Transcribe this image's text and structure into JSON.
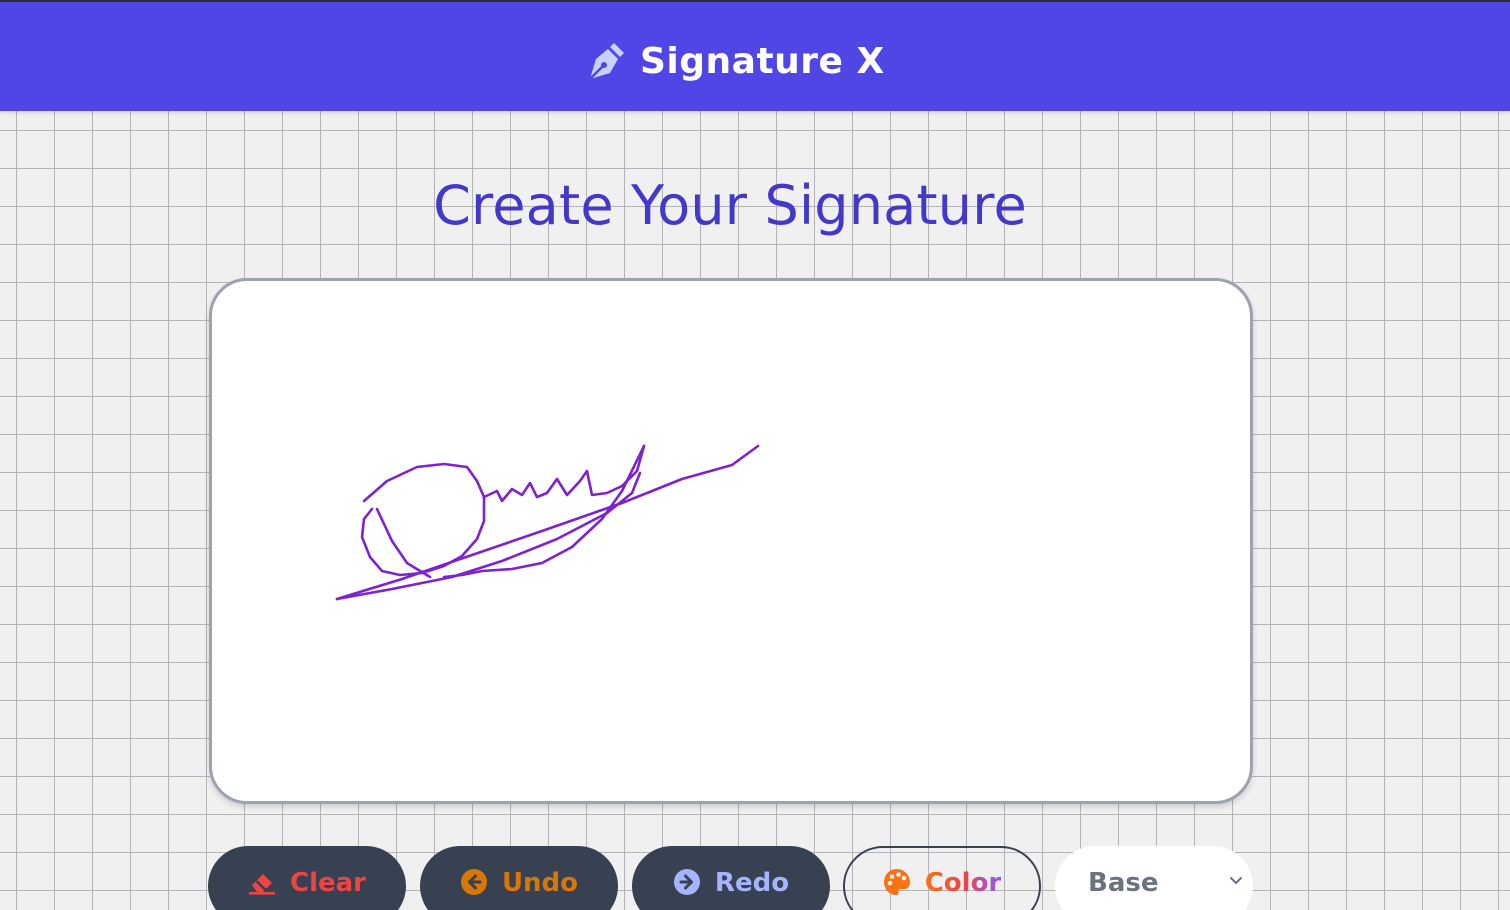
{
  "app": {
    "title": "Signature X",
    "accent_color": "#4f46e5",
    "logo_icon": "pen-nib-icon"
  },
  "main": {
    "heading": "Create Your Signature",
    "pad": {
      "stroke_color": "#7e22ce",
      "background": "#ffffff"
    }
  },
  "toolbar": {
    "clear": {
      "label": "Clear",
      "icon": "eraser-icon",
      "color": "#ef4444"
    },
    "undo": {
      "label": "Undo",
      "icon": "arrow-left-circle-icon",
      "color": "#d97706"
    },
    "redo": {
      "label": "Redo",
      "icon": "arrow-right-circle-icon",
      "color": "#a5b4fc"
    },
    "color": {
      "label": "Color",
      "icon": "palette-icon",
      "color": "#f97316"
    },
    "size_select": {
      "value": "Base",
      "icon": "chevron-down-icon"
    }
  }
}
